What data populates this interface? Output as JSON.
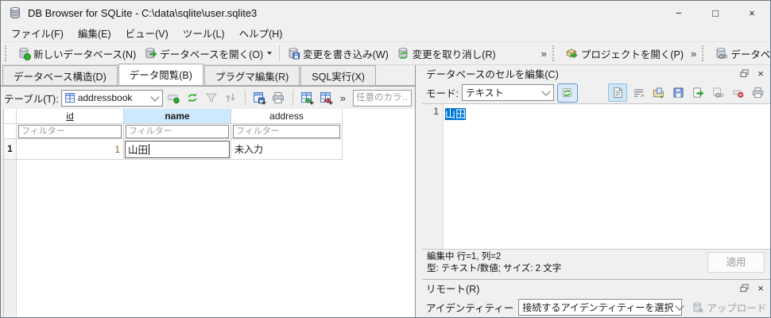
{
  "window": {
    "title": "DB Browser for SQLite - C:\\data\\sqlite\\user.sqlite3",
    "controls": {
      "minimize": "−",
      "maximize": "□",
      "close": "×"
    }
  },
  "menu": {
    "items": [
      "ファイル(F)",
      "編集(E)",
      "ビュー(V)",
      "ツール(L)",
      "ヘルプ(H)"
    ]
  },
  "toolbar": {
    "new_db": "新しいデータベース(N)",
    "open_db": "データベースを開く(O)",
    "write_changes": "変更を書き込み(W)",
    "revert_changes": "変更を取り消し(R)",
    "open_project": "プロジェクトを開く(P)",
    "connect_db": "データベースに接続(A)",
    "overflow": "»"
  },
  "tabs": [
    {
      "label": "データベース構造(D)",
      "active": false
    },
    {
      "label": "データ閲覧(B)",
      "active": true
    },
    {
      "label": "プラグマ編集(R)",
      "active": false
    },
    {
      "label": "SQL実行(X)",
      "active": false
    }
  ],
  "browse": {
    "table_label": "テーブル(T):",
    "table_selected": "addressbook",
    "filter_any_placeholder": "任意のカラ…",
    "grid": {
      "columns": [
        "id",
        "name",
        "address"
      ],
      "filter_placeholder": "フィルター",
      "rows": [
        {
          "num": "1",
          "id": "1",
          "name": "山田",
          "address": "未入力"
        }
      ]
    }
  },
  "cell_editor": {
    "title": "データベースのセルを編集(C)",
    "mode_label": "モード:",
    "mode_value": "テキスト",
    "line_number": "1",
    "content": "山田",
    "status_line1": "編集中 行=1, 列=2",
    "status_line2": "型: テキスト/数値; サイズ: 2 文字",
    "apply_label": "適用"
  },
  "remote": {
    "title": "リモート(R)",
    "identity_label": "アイデンティティー",
    "identity_value": "接続するアイデンティティーを選択",
    "upload_label": "アップロード"
  },
  "icons": {
    "app": "database-stack",
    "toolbar": [
      "new-database",
      "open-database",
      "write-changes",
      "revert-changes",
      "open-project",
      "connect-database"
    ],
    "browse_toolbar": [
      "insert-record",
      "refresh",
      "filter",
      "sort",
      "save-results",
      "print",
      "import-table",
      "export-table"
    ],
    "cell_editor_toolbar": [
      "text-mode",
      "word-wrap",
      "import-file",
      "save-file",
      "export-data",
      "link-data",
      "set-null",
      "print"
    ]
  },
  "colors": {
    "selection_blue": "#0078d7",
    "column_highlight": "#cde8ff",
    "chrome": "#f0f0f0",
    "icon_green": "#2fae2f",
    "icon_blue": "#4a78c8",
    "id_value_text": "#8a6d1a"
  }
}
